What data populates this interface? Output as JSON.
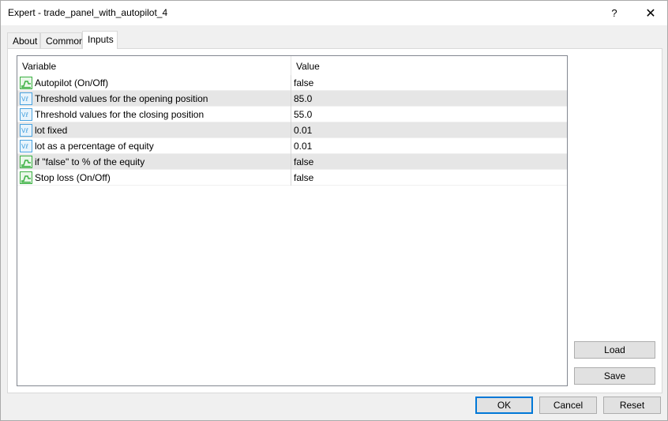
{
  "window": {
    "title": "Expert - trade_panel_with_autopilot_4",
    "help_glyph": "?",
    "close_glyph": "✕"
  },
  "tabs": [
    {
      "label": "About"
    },
    {
      "label": "Common"
    },
    {
      "label": "Inputs"
    }
  ],
  "table": {
    "headers": {
      "variable": "Variable",
      "value": "Value"
    },
    "rows": [
      {
        "icon": "bool-icon",
        "variable": "Autopilot (On/Off)",
        "value": "false"
      },
      {
        "icon": "value-icon",
        "variable": "Threshold values for the opening position",
        "value": "85.0"
      },
      {
        "icon": "value-icon",
        "variable": "Threshold values for the closing position",
        "value": "55.0"
      },
      {
        "icon": "value-icon",
        "variable": "lot fixed",
        "value": "0.01"
      },
      {
        "icon": "value-icon",
        "variable": "lot as a percentage of equity",
        "value": "0.01"
      },
      {
        "icon": "bool-icon",
        "variable": "if \"false\" to % of the equity",
        "value": "false"
      },
      {
        "icon": "bool-icon",
        "variable": "Stop loss (On/Off)",
        "value": "false"
      }
    ]
  },
  "side_buttons": {
    "load": "Load",
    "save": "Save"
  },
  "footer_buttons": {
    "ok": "OK",
    "cancel": "Cancel",
    "reset": "Reset"
  },
  "colors": {
    "accent": "#0078d7",
    "row_alt": "#e6e6e6",
    "bool_icon": "#3cb043",
    "value_icon": "#4aa3df"
  }
}
